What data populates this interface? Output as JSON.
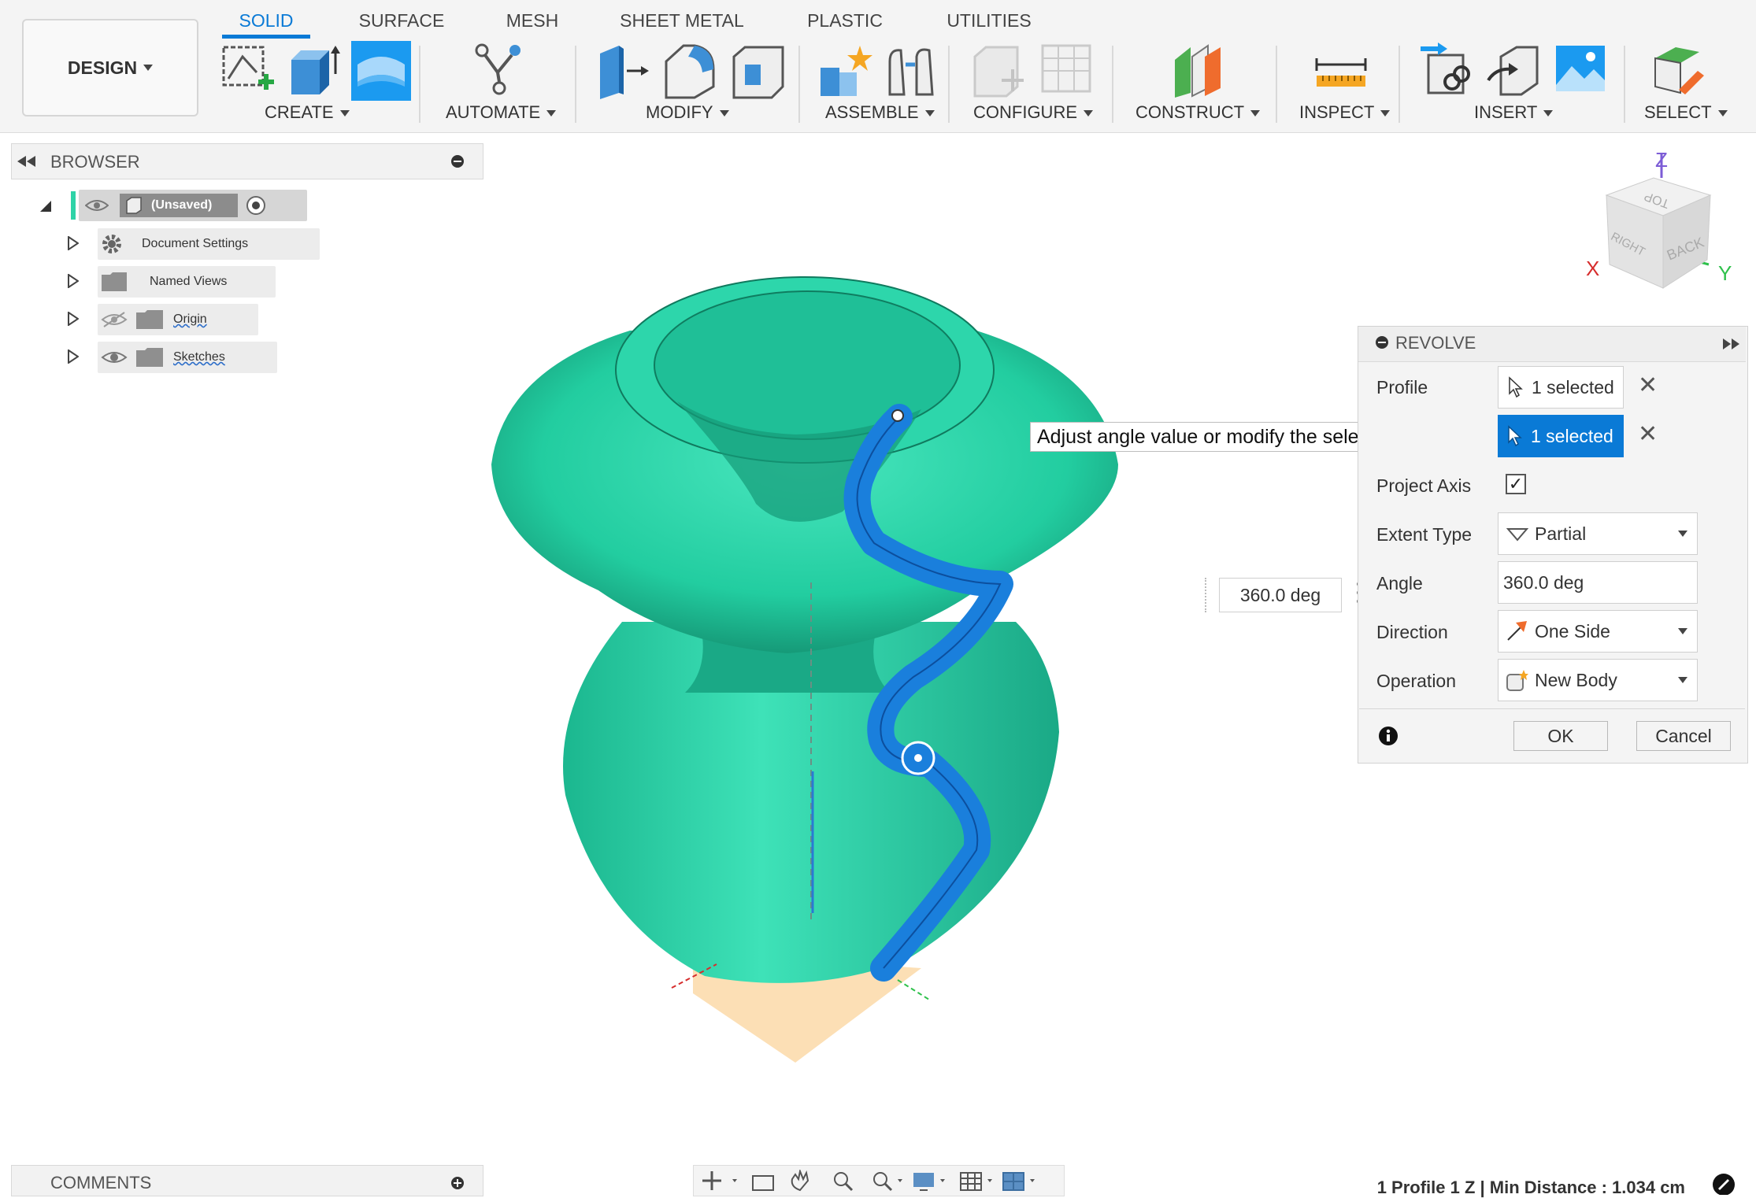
{
  "toolbar": {
    "design_label": "DESIGN",
    "tabs": [
      "SOLID",
      "SURFACE",
      "MESH",
      "SHEET METAL",
      "PLASTIC",
      "UTILITIES"
    ],
    "groups": [
      "CREATE",
      "AUTOMATE",
      "MODIFY",
      "ASSEMBLE",
      "CONFIGURE",
      "CONSTRUCT",
      "INSPECT",
      "INSERT",
      "SELECT"
    ]
  },
  "browser": {
    "title": "BROWSER",
    "root": "(Unsaved)",
    "items": [
      "Document Settings",
      "Named Views",
      "Origin",
      "Sketches"
    ]
  },
  "revolve": {
    "title": "REVOLVE",
    "profile_label": "Profile",
    "profile_value": "1 selected",
    "axis_value": "1 selected",
    "project_axis_label": "Project Axis",
    "extent_type_label": "Extent Type",
    "extent_type_value": "Partial",
    "angle_label": "Angle",
    "angle_value": "360.0 deg",
    "direction_label": "Direction",
    "direction_value": "One Side",
    "operation_label": "Operation",
    "operation_value": "New Body",
    "ok_label": "OK",
    "cancel_label": "Cancel"
  },
  "tooltip": "Adjust angle value or modify the selection",
  "viewport_angle": "360.0 deg",
  "viewcube": {
    "z": "Z",
    "x": "X",
    "y": "Y",
    "top": "TOP",
    "right": "RIGHT",
    "back": "BACK"
  },
  "comments_label": "COMMENTS",
  "status_text": "1 Profile 1 Z | Min Distance : 1.034 cm",
  "colors": {
    "accent": "#0a7ad6",
    "model": "#2ed3a7",
    "profile": "#1877d2"
  }
}
